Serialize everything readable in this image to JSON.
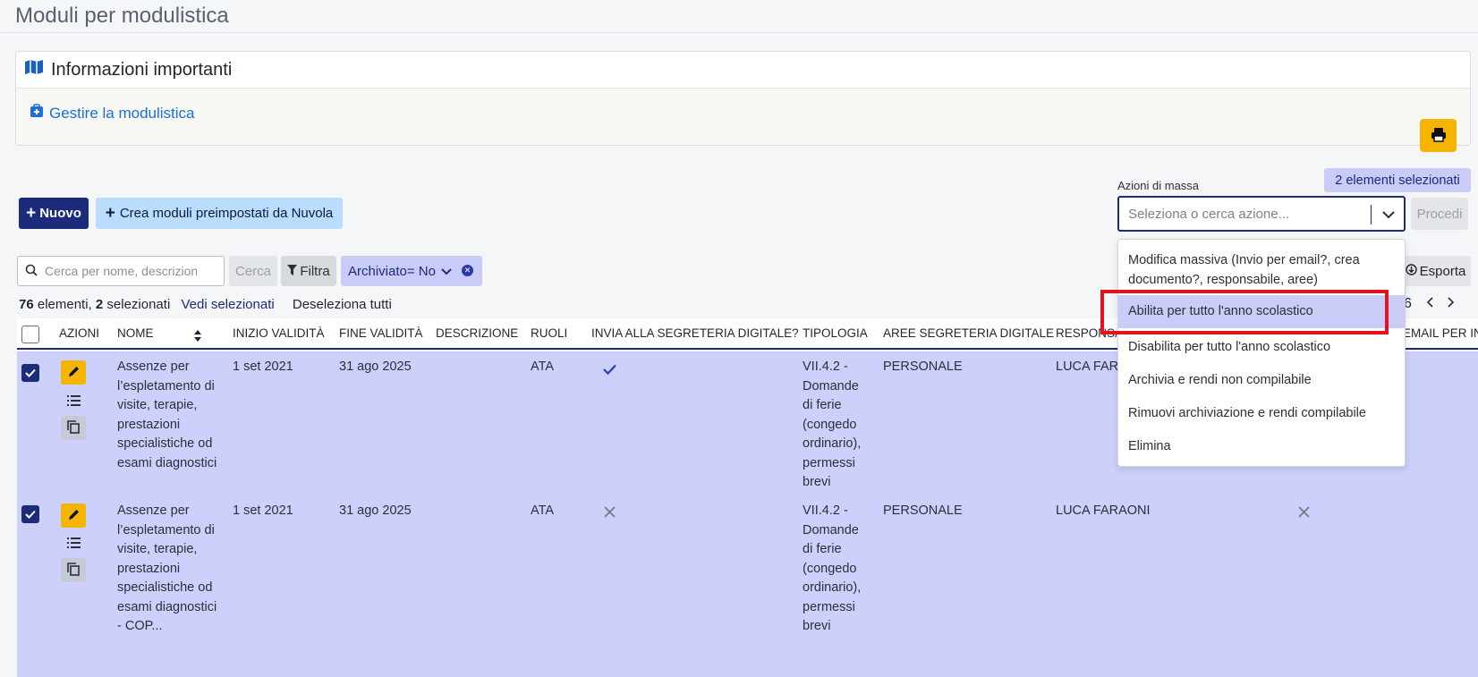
{
  "page": {
    "title": "Moduli per modulistica"
  },
  "info": {
    "title": "Informazioni importanti",
    "link": "Gestire la modulistica"
  },
  "toolbar": {
    "new_label": "Nuovo",
    "preset_label": "Crea moduli preimpostati da Nuvola",
    "search_placeholder": "Cerca per nome, descrizione",
    "search_button": "Cerca",
    "filter_button": "Filtra",
    "filter_chip": "Archiviato= No",
    "export_button": "Esporta"
  },
  "summary": {
    "count": "76",
    "count_text": " elementi, ",
    "selected": "2",
    "selected_text": " selezionati",
    "view_selected": "Vedi selezionati",
    "deselect_all": "Deseleziona tutti"
  },
  "mass": {
    "label": "Azioni di massa",
    "selected_badge": "2 elementi selezionati",
    "placeholder": "Seleziona o cerca azione...",
    "proceed": "Procedi",
    "options": [
      "Modifica massiva (Invio per email?, crea documento?, responsabile, aree)",
      "Abilita per tutto l'anno scolastico",
      "Disabilita per tutto l'anno scolastico",
      "Archivia e rendi non compilabile",
      "Rimuovi archiviazione e rendi compilabile",
      "Elimina"
    ],
    "active_index": 1
  },
  "pager": {
    "page": "6"
  },
  "table": {
    "headers": [
      "Azioni",
      "Nome",
      "Inizio validità",
      "Fine validità",
      "Descrizione",
      "Ruoli",
      "Invia alla segreteria digitale?",
      "Tipologia",
      "Aree segreteria digitale",
      "Responsa",
      "Email per in"
    ],
    "rows": [
      {
        "nome": "Assenze per l’espletamento di visite, terapie, prestazioni specialistiche od esami diagnostici",
        "inizio": "1 set 2021",
        "fine": "31 ago 2025",
        "ruoli": "ATA",
        "tipologia": "VII.4.2 - Domande di ferie (congedo ordinario), permessi brevi",
        "aree": "PERSONALE",
        "responsabile": "LUCA FARA"
      },
      {
        "nome": "Assenze per l’espletamento di visite, terapie, prestazioni specialistiche od esami diagnostici - COP...",
        "inizio": "1 set 2021",
        "fine": "31 ago 2025",
        "ruoli": "ATA",
        "tipologia": "VII.4.2 - Domande di ferie (congedo ordinario), permessi brevi",
        "aree": "PERSONALE",
        "responsabile": "LUCA FARAONI"
      }
    ]
  },
  "colors": {
    "primary": "#1c2b7a",
    "selected_row": "#cdd0fb",
    "warning": "#f4b400",
    "highlight": "#e3121b"
  }
}
